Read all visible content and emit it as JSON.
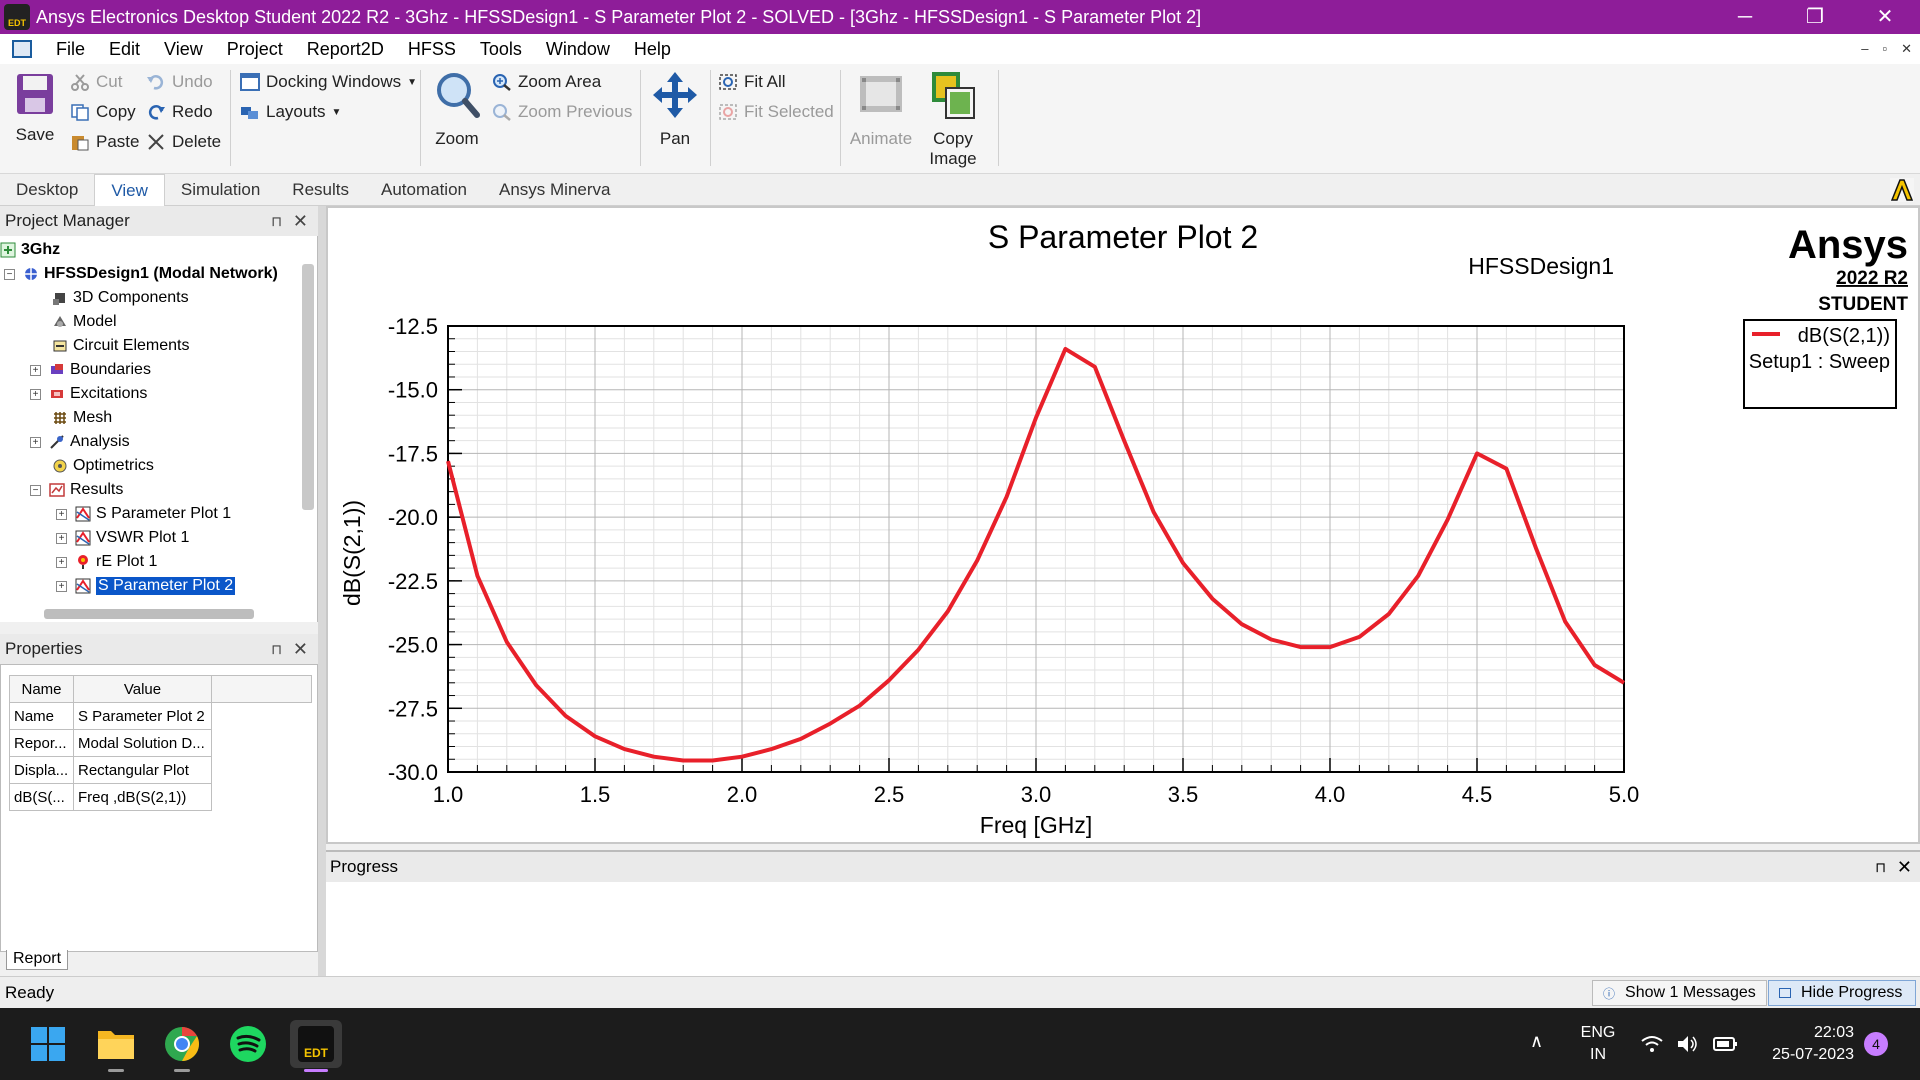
{
  "window": {
    "title": "Ansys Electronics Desktop Student 2022 R2 - 3Ghz - HFSSDesign1 - S Parameter Plot 2 - SOLVED - [3Ghz - HFSSDesign1 - S Parameter Plot 2]",
    "app_logo_text": "EDT",
    "minimize": "─",
    "restore": "❐",
    "close": "✕"
  },
  "menu": {
    "items": [
      "File",
      "Edit",
      "View",
      "Project",
      "Report2D",
      "HFSS",
      "Tools",
      "Window",
      "Help"
    ],
    "mdi": [
      "–",
      "▫",
      "✕"
    ]
  },
  "ribbon": {
    "save": "Save",
    "cut": "Cut",
    "copy": "Copy",
    "paste": "Paste",
    "undo": "Undo",
    "redo": "Redo",
    "delete": "Delete",
    "docking_windows": "Docking Windows",
    "layouts": "Layouts",
    "zoom": "Zoom",
    "zoom_area": "Zoom Area",
    "zoom_previous": "Zoom Previous",
    "pan": "Pan",
    "fit_all": "Fit All",
    "fit_selected": "Fit Selected",
    "animate": "Animate",
    "copy_image_1": "Copy",
    "copy_image_2": "Image"
  },
  "tabs": [
    "Desktop",
    "View",
    "Simulation",
    "Results",
    "Automation",
    "Ansys Minerva"
  ],
  "project_manager": {
    "title": "Project Manager",
    "pin": "⊓",
    "close": "✕",
    "tree": {
      "project": "3Ghz",
      "design": "HFSSDesign1 (Modal Network)",
      "items": [
        "3D Components",
        "Model",
        "Circuit Elements",
        "Boundaries",
        "Excitations",
        "Mesh",
        "Analysis",
        "Optimetrics",
        "Results"
      ],
      "results": [
        "S Parameter Plot 1",
        "VSWR Plot 1",
        "rE Plot 1",
        "S Parameter Plot 2"
      ]
    }
  },
  "properties": {
    "title": "Properties",
    "pin": "⊓",
    "close": "✕",
    "headers": [
      "Name",
      "Value"
    ],
    "rows": [
      [
        "Name",
        "S Parameter Plot 2"
      ],
      [
        "Repor...",
        "Modal Solution D..."
      ],
      [
        "Displa...",
        "Rectangular Plot"
      ],
      [
        "dB(S(...",
        "Freq ,dB(S(2,1))"
      ]
    ],
    "report_tab": "Report"
  },
  "plot": {
    "brand": "Ansys",
    "version": "2022 R2",
    "edition": "STUDENT",
    "design_name": "HFSSDesign1"
  },
  "chart_data": {
    "type": "line",
    "title": "S Parameter Plot 2",
    "xlabel": "Freq [GHz]",
    "ylabel": "dB(S(2,1))",
    "xlim": [
      1.0,
      5.0
    ],
    "ylim": [
      -30.0,
      -12.5
    ],
    "xticks": [
      "1.0",
      "1.5",
      "2.0",
      "2.5",
      "3.0",
      "3.5",
      "4.0",
      "4.5",
      "5.0"
    ],
    "yticks": [
      "-12.5",
      "-15.0",
      "-17.5",
      "-20.0",
      "-22.5",
      "-25.0",
      "-27.5",
      "-30.0"
    ],
    "grid": true,
    "legend": "top-right",
    "series": [
      {
        "name": "dB(S(2,1))",
        "legend_sub": "Setup1 : Sweep",
        "color": "#e8202a",
        "x": [
          1.0,
          1.1,
          1.2,
          1.3,
          1.4,
          1.5,
          1.6,
          1.7,
          1.8,
          1.9,
          2.0,
          2.1,
          2.2,
          2.3,
          2.4,
          2.5,
          2.6,
          2.7,
          2.8,
          2.9,
          3.0,
          3.1,
          3.2,
          3.3,
          3.4,
          3.5,
          3.6,
          3.7,
          3.8,
          3.9,
          4.0,
          4.1,
          4.2,
          4.3,
          4.4,
          4.5,
          4.6,
          4.7,
          4.8,
          4.9,
          5.0
        ],
        "y": [
          -17.8,
          -22.3,
          -24.9,
          -26.6,
          -27.8,
          -28.6,
          -29.1,
          -29.4,
          -29.55,
          -29.55,
          -29.4,
          -29.1,
          -28.7,
          -28.1,
          -27.4,
          -26.4,
          -25.2,
          -23.7,
          -21.7,
          -19.2,
          -16.1,
          -13.4,
          -14.1,
          -17.0,
          -19.8,
          -21.8,
          -23.2,
          -24.2,
          -24.8,
          -25.1,
          -25.1,
          -24.7,
          -23.8,
          -22.3,
          -20.1,
          -17.5,
          -18.1,
          -21.2,
          -24.1,
          -25.8,
          -26.5
        ]
      }
    ]
  },
  "progress": {
    "title": "Progress",
    "pin": "⊓",
    "close": "✕"
  },
  "statusbar": {
    "status": "Ready",
    "messages_btn": "Show 1 Messages",
    "hide_progress_btn": "Hide Progress"
  },
  "taskbar": {
    "edt_label": "EDT",
    "tray_chevron": "∧",
    "lang_1": "ENG",
    "lang_2": "IN",
    "time": "22:03",
    "date": "25-07-2023",
    "notif_count": "4"
  }
}
